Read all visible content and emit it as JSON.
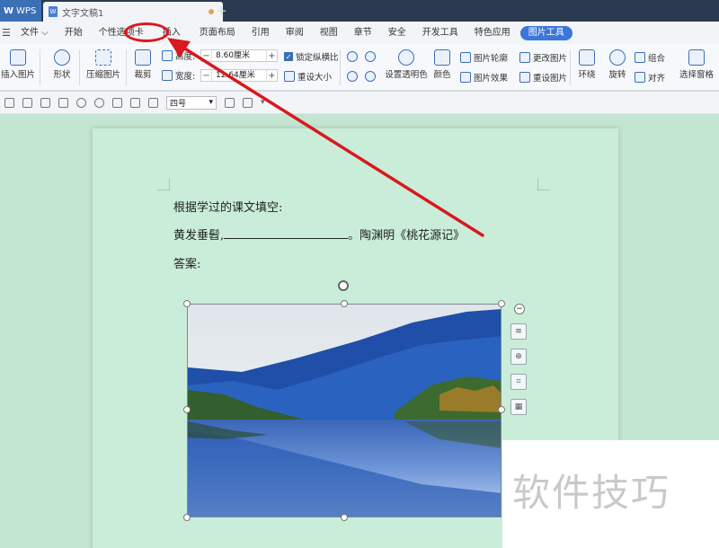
{
  "titlebar": {
    "app_tab": "WPS",
    "doc_tab": "文字文稿1",
    "add_tab": "+"
  },
  "menubar": {
    "file": "文件",
    "items": [
      "开始",
      "个性选项卡",
      "插入",
      "页面布局",
      "引用",
      "审阅",
      "视图",
      "章节",
      "安全",
      "开发工具",
      "特色应用"
    ],
    "picture_tools": "图片工具"
  },
  "ribbon": {
    "insert_picture": "插入图片",
    "shape": "形状",
    "compress": "压缩图片",
    "crop": "裁剪",
    "height_label": "高度:",
    "height_value": "8.60厘米",
    "width_label": "宽度:",
    "width_value": "12.64厘米",
    "lock_ratio": "锁定纵横比",
    "reset_size": "重设大小",
    "set_transparent": "设置透明色",
    "color": "颜色",
    "outline": "图片轮廓",
    "effects": "图片效果",
    "change_picture": "更改图片",
    "reset_picture": "重设图片",
    "wrap": "环绕",
    "rotate": "旋转",
    "group": "组合",
    "align": "对齐",
    "select_pane": "选择窗格"
  },
  "quickbar": {
    "font_size": "四号"
  },
  "document": {
    "line1": "根据学过的课文填空:",
    "line2_prefix": "黄发垂髫,",
    "line2_suffix": "。陶渊明《桃花源记》",
    "line3": "答案:"
  },
  "watermark": "软件技巧",
  "colors": {
    "accent": "#3d76d9",
    "annotation_red": "#d9181f",
    "canvas_bg": "#c3e6d2"
  }
}
